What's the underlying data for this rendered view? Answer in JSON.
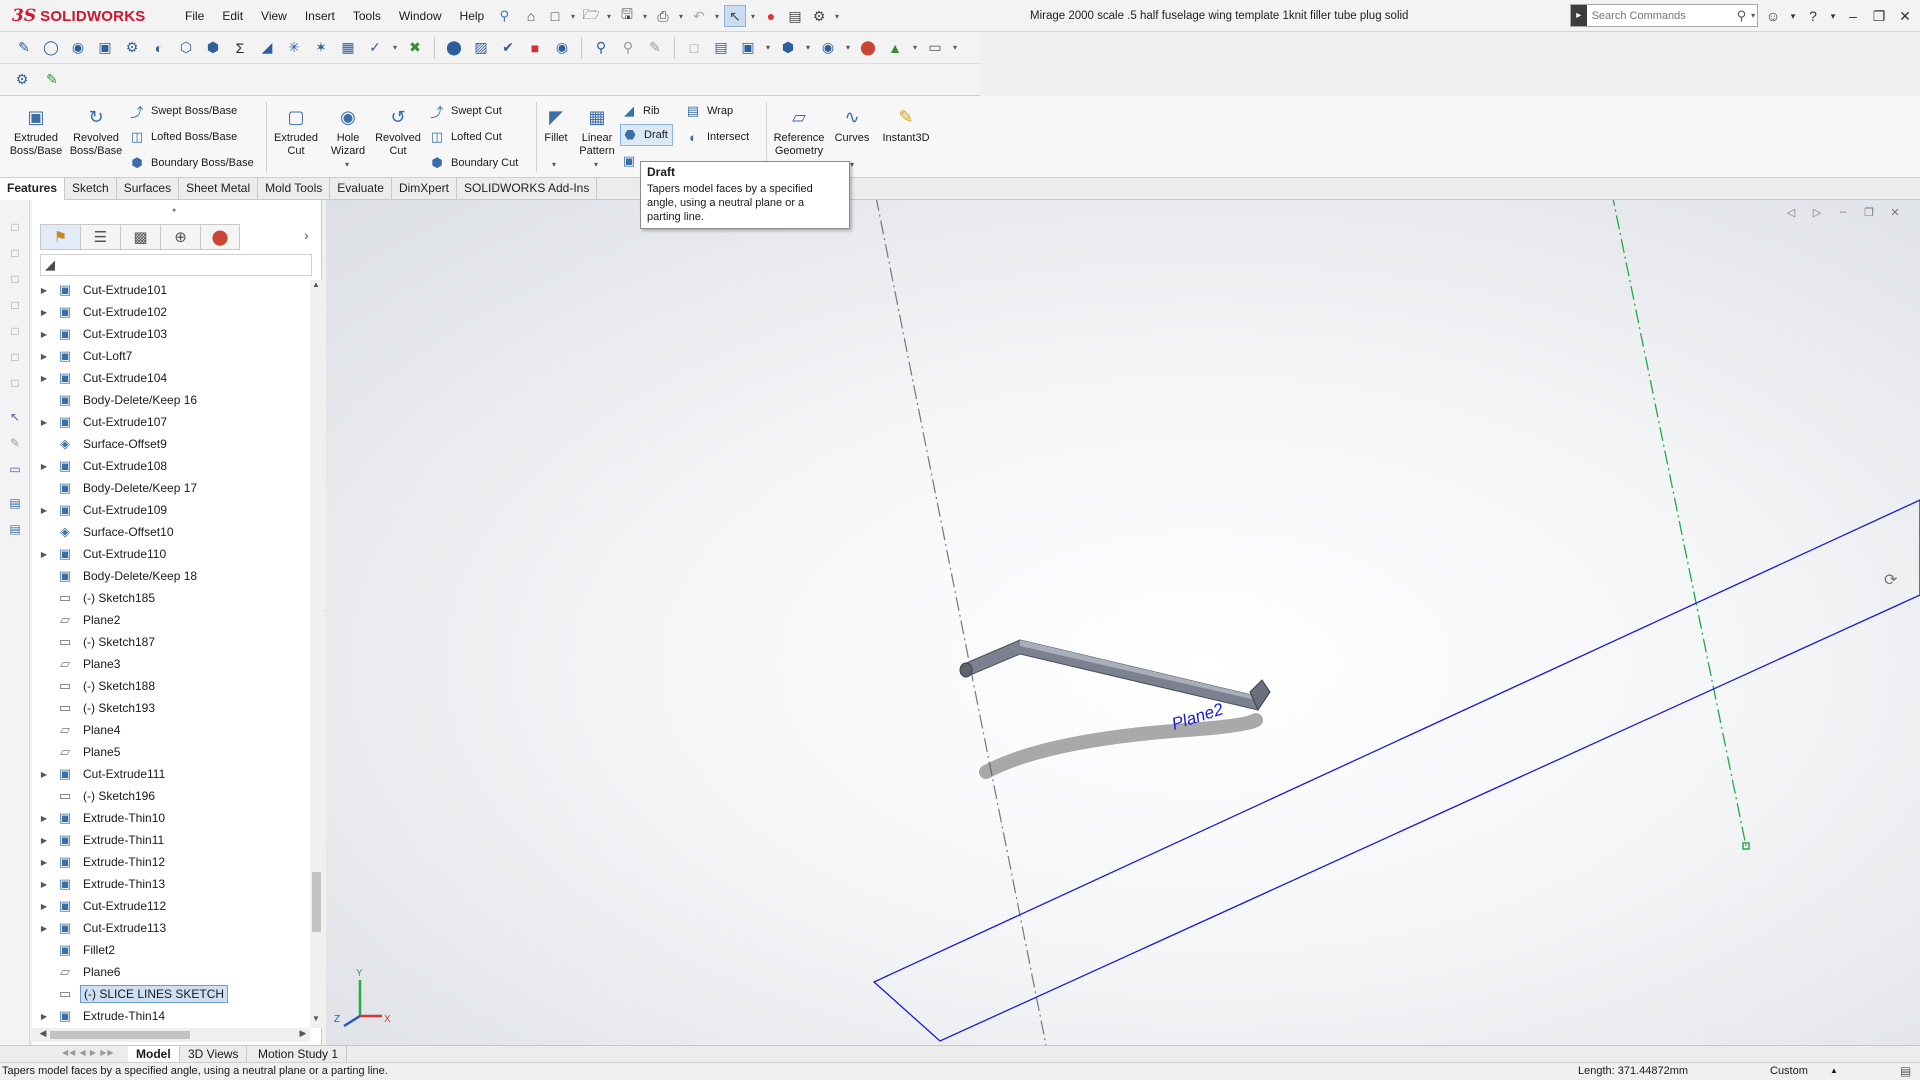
{
  "app": {
    "logo_ds": "3S",
    "logo_name": "SOLIDWORKS",
    "document_title": "Mirage 2000 scale .5 half fuselage wing template 1knit filler tube plug solid"
  },
  "menu": [
    "File",
    "Edit",
    "View",
    "Insert",
    "Tools",
    "Window",
    "Help"
  ],
  "search": {
    "placeholder": "Search Commands"
  },
  "command_manager": {
    "extruded_boss": [
      "Extruded",
      "Boss/Base"
    ],
    "revolved_boss": [
      "Revolved",
      "Boss/Base"
    ],
    "swept_boss": "Swept Boss/Base",
    "lofted_boss": "Lofted Boss/Base",
    "boundary_boss": "Boundary Boss/Base",
    "extruded_cut": [
      "Extruded",
      "Cut"
    ],
    "hole_wizard": [
      "Hole",
      "Wizard"
    ],
    "revolved_cut": [
      "Revolved",
      "Cut"
    ],
    "swept_cut": "Swept Cut",
    "lofted_cut": "Lofted Cut",
    "boundary_cut": "Boundary Cut",
    "fillet": "Fillet",
    "linear_pattern": [
      "Linear",
      "Pattern"
    ],
    "rib": "Rib",
    "draft": "Draft",
    "wrap": "Wrap",
    "intersect": "Intersect",
    "reference_geometry": [
      "Reference",
      "Geometry"
    ],
    "curves": "Curves",
    "instant3d": "Instant3D"
  },
  "tabs": [
    "Features",
    "Sketch",
    "Surfaces",
    "Sheet Metal",
    "Mold Tools",
    "Evaluate",
    "DimXpert",
    "SOLIDWORKS Add-Ins"
  ],
  "tooltip": {
    "title": "Draft",
    "lines": [
      "Tapers model faces by a specified",
      "angle, using a neutral plane or a",
      "parting line."
    ]
  },
  "tree": [
    {
      "label": "Cut-Extrude101",
      "type": "feature",
      "expand": true
    },
    {
      "label": "Cut-Extrude102",
      "type": "feature",
      "expand": true
    },
    {
      "label": "Cut-Extrude103",
      "type": "feature",
      "expand": true
    },
    {
      "label": "Cut-Loft7",
      "type": "feature",
      "expand": true
    },
    {
      "label": "Cut-Extrude104",
      "type": "feature",
      "expand": true
    },
    {
      "label": "Body-Delete/Keep 16",
      "type": "feature",
      "expand": false
    },
    {
      "label": "Cut-Extrude107",
      "type": "feature",
      "expand": true
    },
    {
      "label": "Surface-Offset9",
      "type": "surface",
      "expand": false
    },
    {
      "label": "Cut-Extrude108",
      "type": "feature",
      "expand": true
    },
    {
      "label": "Body-Delete/Keep 17",
      "type": "feature",
      "expand": false
    },
    {
      "label": "Cut-Extrude109",
      "type": "feature",
      "expand": true
    },
    {
      "label": "Surface-Offset10",
      "type": "surface",
      "expand": false
    },
    {
      "label": "Cut-Extrude110",
      "type": "feature",
      "expand": true
    },
    {
      "label": "Body-Delete/Keep 18",
      "type": "feature",
      "expand": false
    },
    {
      "label": "(-) Sketch185",
      "type": "sketch",
      "expand": false
    },
    {
      "label": "Plane2",
      "type": "plane",
      "expand": false
    },
    {
      "label": "(-) Sketch187",
      "type": "sketch",
      "expand": false
    },
    {
      "label": "Plane3",
      "type": "plane",
      "expand": false
    },
    {
      "label": "(-) Sketch188",
      "type": "sketch",
      "expand": false
    },
    {
      "label": "(-) Sketch193",
      "type": "sketch",
      "expand": false
    },
    {
      "label": "Plane4",
      "type": "plane",
      "expand": false
    },
    {
      "label": "Plane5",
      "type": "plane",
      "expand": false
    },
    {
      "label": "Cut-Extrude111",
      "type": "feature",
      "expand": true
    },
    {
      "label": "(-) Sketch196",
      "type": "sketch",
      "expand": false
    },
    {
      "label": "Extrude-Thin10",
      "type": "feature",
      "expand": true
    },
    {
      "label": "Extrude-Thin11",
      "type": "feature",
      "expand": true
    },
    {
      "label": "Extrude-Thin12",
      "type": "feature",
      "expand": true
    },
    {
      "label": "Extrude-Thin13",
      "type": "feature",
      "expand": true
    },
    {
      "label": "Cut-Extrude112",
      "type": "feature",
      "expand": true
    },
    {
      "label": "Cut-Extrude113",
      "type": "feature",
      "expand": true
    },
    {
      "label": "Fillet2",
      "type": "feature",
      "expand": false
    },
    {
      "label": "Plane6",
      "type": "plane",
      "expand": false
    },
    {
      "label": "(-) SLICE LINES SKETCH",
      "type": "sketch",
      "expand": false,
      "selected": true
    },
    {
      "label": "Extrude-Thin14",
      "type": "feature",
      "expand": true
    }
  ],
  "viewport": {
    "plane_label": "Plane2",
    "triad_labels": {
      "x": "X",
      "y": "Y",
      "z": "Z"
    }
  },
  "bottom_tabs": [
    "Model",
    "3D Views",
    "Motion Study 1"
  ],
  "status": {
    "message": "Tapers model faces by a specified angle, using a neutral plane or a parting line.",
    "length": "Length: 371.44872mm",
    "units": "Custom"
  },
  "colors": {
    "brand": "#d0152c",
    "plane_blue": "#1a1ad8",
    "axis_green": "#22aa44",
    "selection": "#cfe0f3"
  }
}
